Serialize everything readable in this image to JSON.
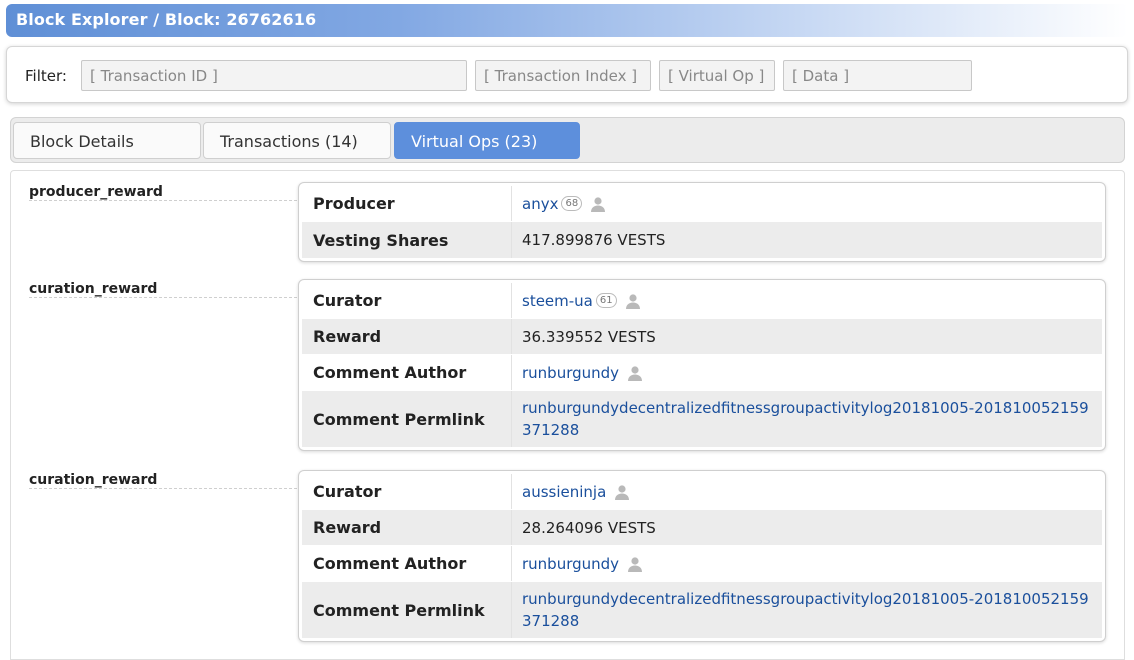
{
  "title": "Block Explorer / Block: 26762616",
  "filter": {
    "label": "Filter:",
    "transaction_id_placeholder": "[ Transaction ID ]",
    "transaction_index_placeholder": "[ Transaction Index ]",
    "virtual_op_placeholder": "[ Virtual Op ]",
    "data_placeholder": "[ Data ]"
  },
  "tabs": [
    {
      "label": "Block Details",
      "active": false
    },
    {
      "label": "Transactions (14)",
      "active": false
    },
    {
      "label": "Virtual Ops (23)",
      "active": true
    }
  ],
  "ops": [
    {
      "name": "producer_reward",
      "rows": [
        {
          "key": "Producer",
          "value": "anyx",
          "rep": "68"
        },
        {
          "key": "Vesting Shares",
          "value": "417.899876 VESTS"
        }
      ]
    },
    {
      "name": "curation_reward",
      "rows": [
        {
          "key": "Curator",
          "value": "steem-ua",
          "rep": "61"
        },
        {
          "key": "Reward",
          "value": "36.339552 VESTS"
        },
        {
          "key": "Comment Author",
          "value": "runburgundy"
        },
        {
          "key": "Comment Permlink",
          "value_line1": "runburgundydecentralizedfitnessgroupactivitylog20181005-201810052159",
          "value_line2": "371288"
        }
      ]
    },
    {
      "name": "curation_reward",
      "rows": [
        {
          "key": "Curator",
          "value": "aussieninja"
        },
        {
          "key": "Reward",
          "value": "28.264096 VESTS"
        },
        {
          "key": "Comment Author",
          "value": "runburgundy"
        },
        {
          "key": "Comment Permlink",
          "value_line1": "runburgundydecentralizedfitnessgroupactivitylog20181005-201810052159",
          "value_line2": "371288"
        }
      ]
    }
  ]
}
